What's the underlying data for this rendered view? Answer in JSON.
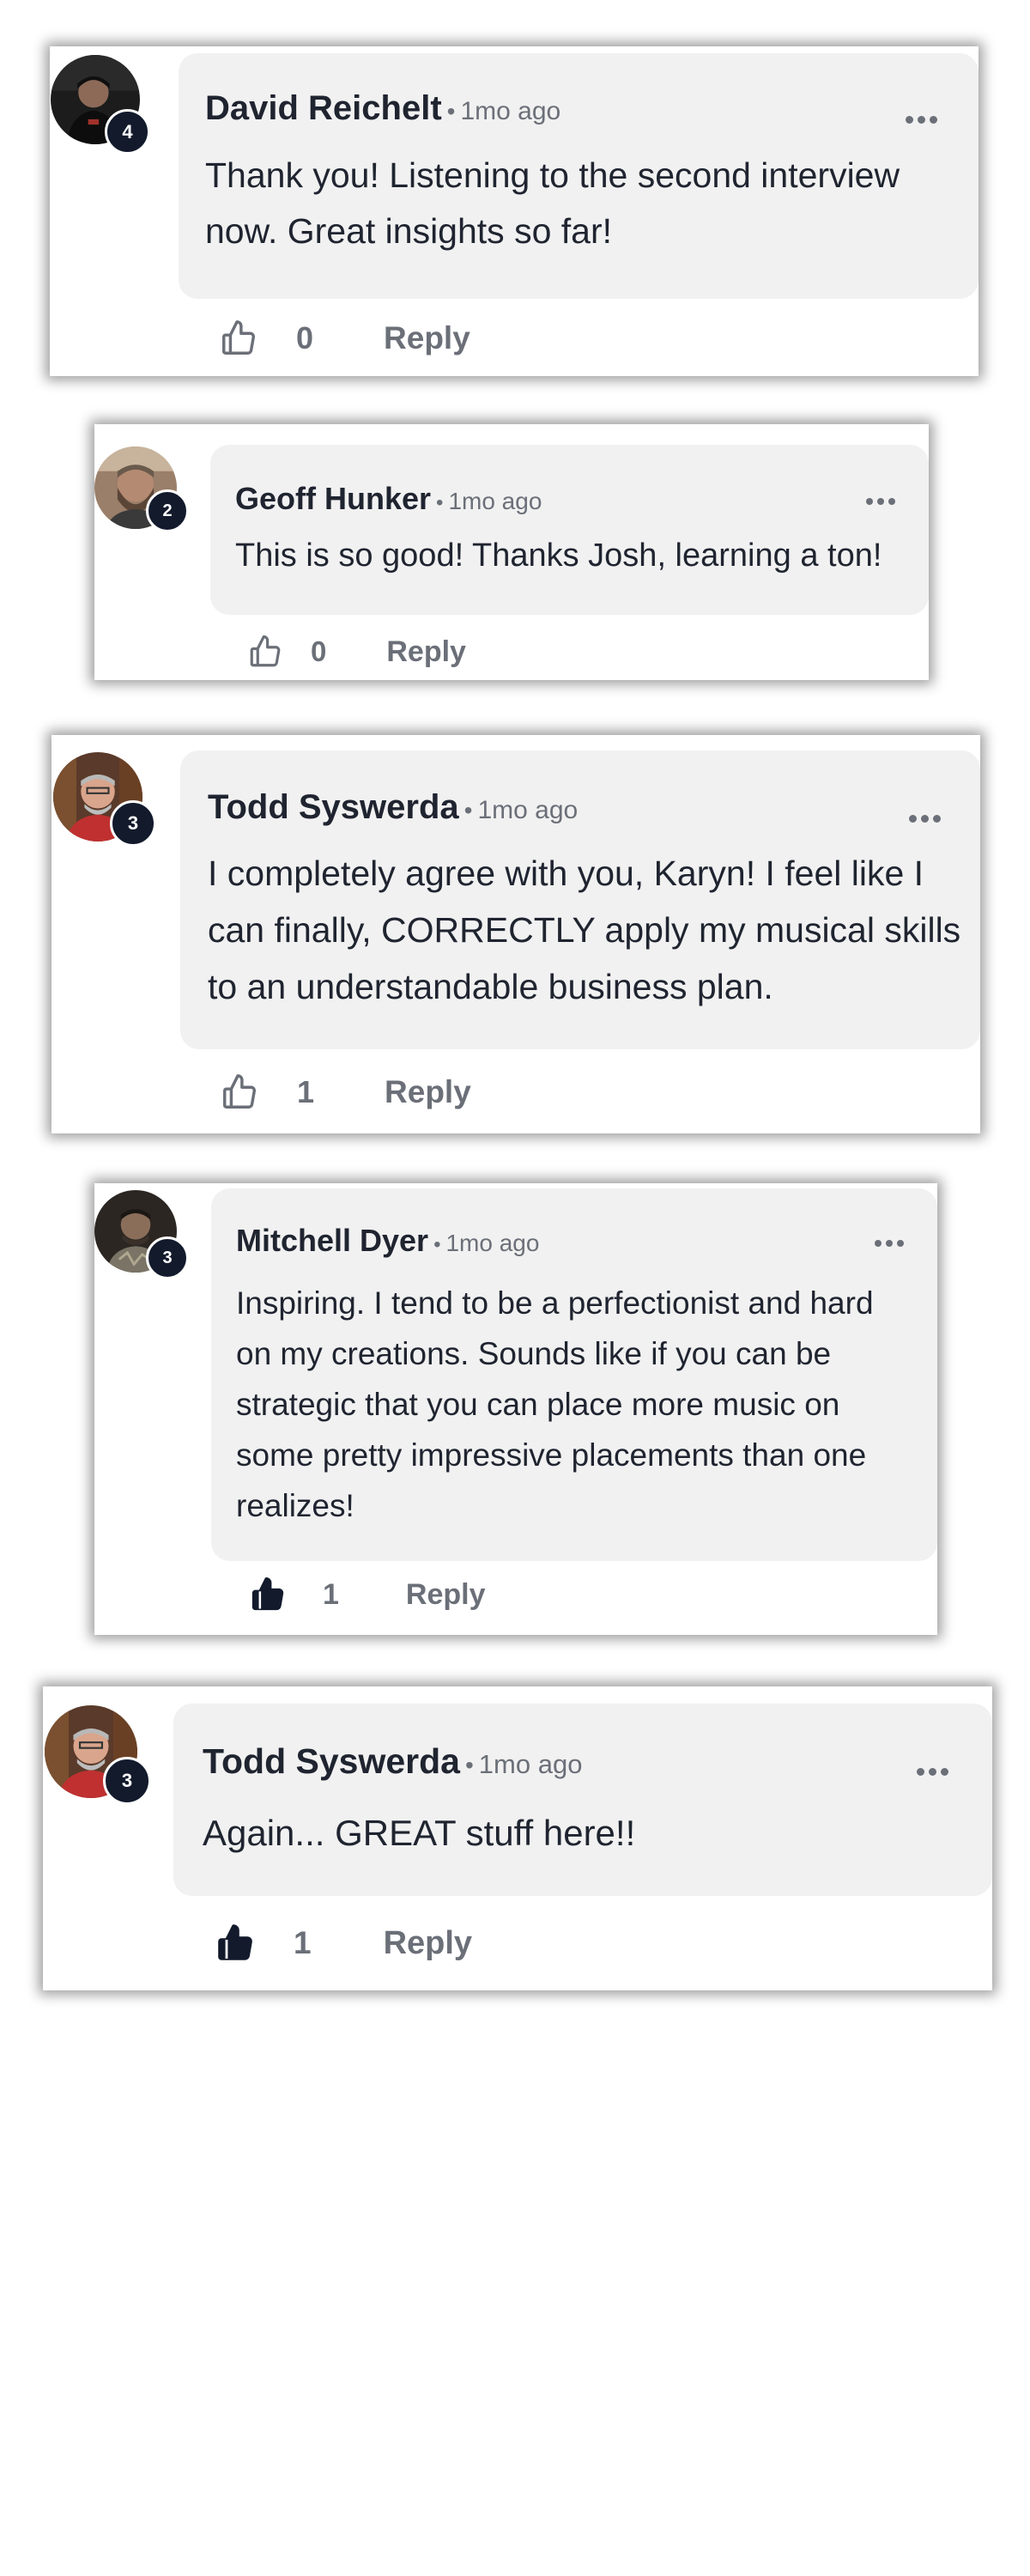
{
  "comments": [
    {
      "author": "David Reichelt",
      "time": "1mo ago",
      "level": "4",
      "text": "Thank you! Listening to the second interview now. Great insights so far!",
      "likes": "0",
      "liked": false,
      "reply_label": "Reply"
    },
    {
      "author": "Geoff Hunker",
      "time": "1mo ago",
      "level": "2",
      "text": "This is so good! Thanks Josh, learning a ton!",
      "likes": "0",
      "liked": false,
      "reply_label": "Reply"
    },
    {
      "author": "Todd Syswerda",
      "time": "1mo ago",
      "level": "3",
      "text": "I completely agree with you, Karyn! I feel like I can finally, CORRECTLY apply my musical skills to an understandable business plan.",
      "likes": "1",
      "liked": false,
      "reply_label": "Reply"
    },
    {
      "author": "Mitchell Dyer",
      "time": "1mo ago",
      "level": "3",
      "text": "Inspiring. I tend to be a perfectionist and hard on my creations. Sounds like if you can be strategic that you can place more music on some pretty impressive placements than one realizes!",
      "likes": "1",
      "liked": true,
      "reply_label": "Reply"
    },
    {
      "author": "Todd Syswerda",
      "time": "1mo ago",
      "level": "3",
      "text": "Again... GREAT stuff here!!",
      "likes": "1",
      "liked": true,
      "reply_label": "Reply"
    }
  ],
  "colors": {
    "badge": "#121a2c",
    "bubble": "#f1f1f1",
    "muted": "#6b6f78",
    "text": "#1f2430"
  },
  "icons": {
    "like": "thumbs-up-icon",
    "more": "more-horizontal-icon",
    "avatar": "user-avatar"
  }
}
